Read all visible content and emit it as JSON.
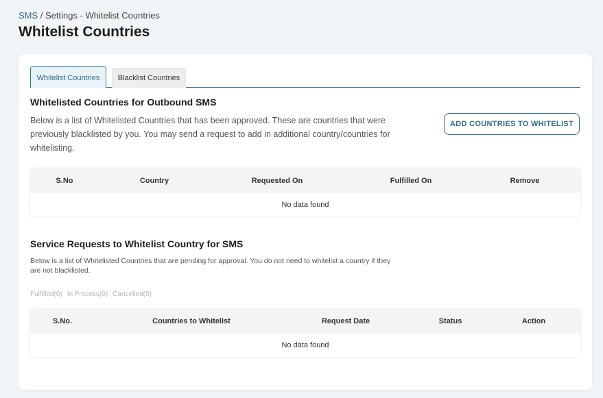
{
  "breadcrumb": {
    "root": "SMS",
    "separator": " / ",
    "rest": "Settings - Whitelist Countries"
  },
  "page_title": "Whitelist Countries",
  "tabs": [
    {
      "label": "Whitelist Countries",
      "active": true
    },
    {
      "label": "Blacklist Countries",
      "active": false
    }
  ],
  "section1": {
    "title": "Whitelisted Countries for Outbound SMS",
    "description": "Below is a list of Whitelisted Countries that has been approved. These are countries that were previously blacklisted by you. You may send a request to add in additional country/countries for whitelisting.",
    "button_label": "ADD COUNTRIES TO WHITELIST",
    "table": {
      "columns": [
        "S.No",
        "Country",
        "Requested On",
        "Fulfilled On",
        "Remove"
      ],
      "empty_text": "No data found"
    }
  },
  "section2": {
    "title": "Service Requests to Whitelist Country for SMS",
    "description": "Below is a list of Whitelisted Countries that are pending for approval. You do not need to whitelist a country if they are not blacklisted.",
    "filters": [
      "Fulfilled(0)",
      "In Process(0)",
      "Cancelled(0)"
    ],
    "table": {
      "columns": [
        "S.No.",
        "Countries to Whitelist",
        "Request Date",
        "Status",
        "Action"
      ],
      "empty_text": "No data found"
    }
  },
  "colors": {
    "accent": "#2f6f8f",
    "page_background": "#f1f4f6",
    "card_background": "#ffffff",
    "table_header_background": "#f4f4f4",
    "filter_text": "#b7b7b7"
  }
}
